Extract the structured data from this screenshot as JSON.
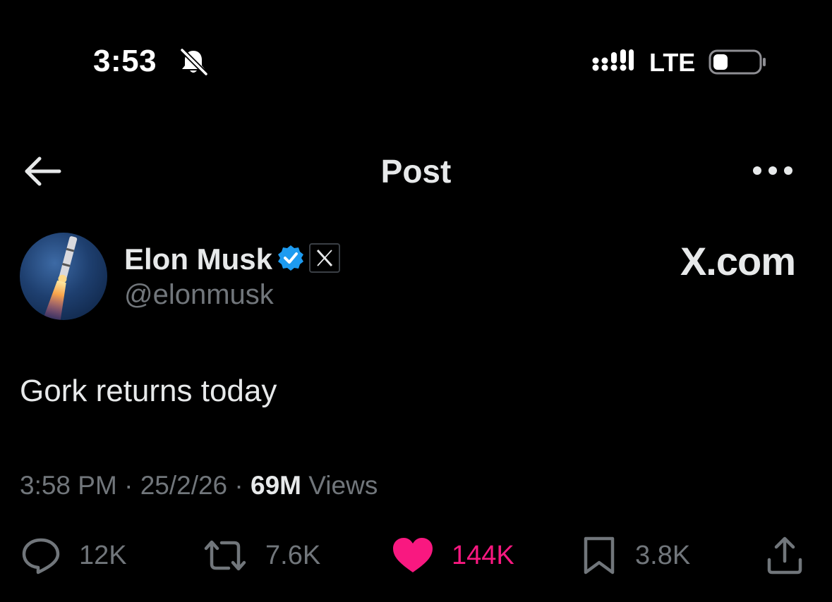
{
  "status_bar": {
    "time": "3:53",
    "network": "LTE"
  },
  "header": {
    "title": "Post"
  },
  "post": {
    "author_name": "Elon Musk",
    "handle": "@elonmusk",
    "source": "X.com",
    "text": "Gork returns today",
    "time": "3:58 PM",
    "date": "25/2/26",
    "views_count": "69M",
    "views_label": "Views"
  },
  "actions": {
    "replies": "12K",
    "reposts": "7.6K",
    "likes": "144K",
    "bookmarks": "3.8K"
  },
  "colors": {
    "background": "#000000",
    "text_primary": "#e7e9ea",
    "text_secondary": "#71767b",
    "verified_blue": "#1d9bf0",
    "like_pink": "#f91880"
  },
  "icons": [
    "bell-slash-icon",
    "cellular-signal-icon",
    "battery-icon",
    "back-arrow-icon",
    "more-icon",
    "verified-icon",
    "x-logo-icon",
    "reply-icon",
    "repost-icon",
    "heart-icon",
    "bookmark-icon",
    "share-icon"
  ]
}
